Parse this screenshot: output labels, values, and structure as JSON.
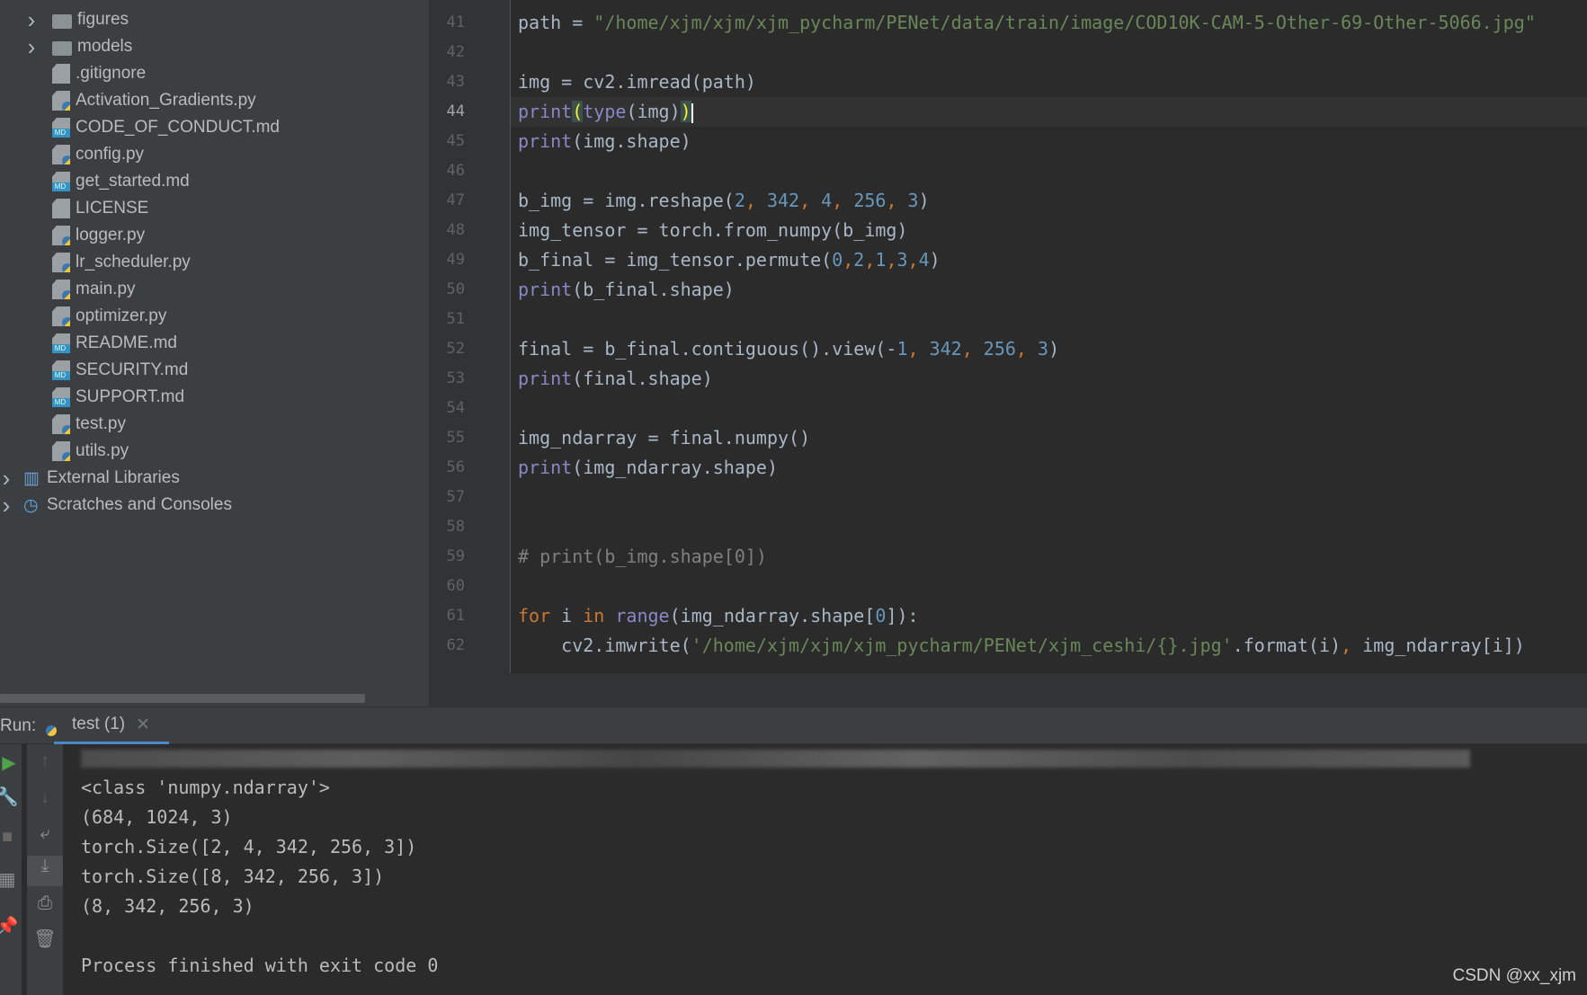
{
  "project_tree": [
    {
      "label": "figures",
      "type": "folder",
      "chevron": true,
      "level": 1
    },
    {
      "label": "models",
      "type": "folder",
      "chevron": true,
      "level": 1
    },
    {
      "label": ".gitignore",
      "type": "doc",
      "level": 1
    },
    {
      "label": "Activation_Gradients.py",
      "type": "py",
      "level": 1
    },
    {
      "label": "CODE_OF_CONDUCT.md",
      "type": "md",
      "level": 1
    },
    {
      "label": "config.py",
      "type": "py",
      "level": 1
    },
    {
      "label": "get_started.md",
      "type": "md",
      "level": 1
    },
    {
      "label": "LICENSE",
      "type": "doc",
      "level": 1
    },
    {
      "label": "logger.py",
      "type": "py",
      "level": 1
    },
    {
      "label": "lr_scheduler.py",
      "type": "py",
      "level": 1
    },
    {
      "label": "main.py",
      "type": "py",
      "level": 1
    },
    {
      "label": "optimizer.py",
      "type": "py",
      "level": 1
    },
    {
      "label": "README.md",
      "type": "md",
      "level": 1
    },
    {
      "label": "SECURITY.md",
      "type": "md",
      "level": 1
    },
    {
      "label": "SUPPORT.md",
      "type": "md",
      "level": 1
    },
    {
      "label": "test.py",
      "type": "py",
      "level": 1
    },
    {
      "label": "utils.py",
      "type": "py",
      "level": 1
    },
    {
      "label": "External Libraries",
      "type": "lib",
      "chevron": true,
      "level": 0
    },
    {
      "label": "Scratches and Consoles",
      "type": "scratch",
      "chevron": true,
      "level": 0
    }
  ],
  "editor": {
    "current_line": 44,
    "lines": [
      {
        "n": "41",
        "t": [
          [
            "path = ",
            ""
          ],
          [
            "\"/home/xjm/xjm/xjm_pycharm/PENet/data/train/image/COD10K-CAM-5-Other-69-Other-5066.jpg\"",
            "s"
          ]
        ]
      },
      {
        "n": "42",
        "t": []
      },
      {
        "n": "43",
        "t": [
          [
            "img = cv2.imread(path)",
            ""
          ]
        ]
      },
      {
        "n": "44",
        "t": [
          [
            "print",
            "b"
          ],
          [
            "(",
            "br"
          ],
          [
            "type",
            "b"
          ],
          [
            "(img)",
            ""
          ],
          [
            ")",
            "br"
          ]
        ]
      },
      {
        "n": "45",
        "t": [
          [
            "print",
            "b"
          ],
          [
            "(img.shape)",
            ""
          ]
        ]
      },
      {
        "n": "46",
        "t": []
      },
      {
        "n": "47",
        "t": [
          [
            "b_img = img.reshape(",
            ""
          ],
          [
            "2",
            "n"
          ],
          [
            ", ",
            "k"
          ],
          [
            "342",
            "n"
          ],
          [
            ", ",
            "k"
          ],
          [
            "4",
            "n"
          ],
          [
            ", ",
            "k"
          ],
          [
            "256",
            "n"
          ],
          [
            ", ",
            "k"
          ],
          [
            "3",
            "n"
          ],
          [
            ")",
            ""
          ]
        ]
      },
      {
        "n": "48",
        "t": [
          [
            "img_tensor = torch.from_numpy(b_img)",
            ""
          ]
        ]
      },
      {
        "n": "49",
        "t": [
          [
            "b_final = img_tensor.permute(",
            ""
          ],
          [
            "0",
            "n"
          ],
          [
            ",",
            "k"
          ],
          [
            "2",
            "n"
          ],
          [
            ",",
            "k"
          ],
          [
            "1",
            "n"
          ],
          [
            ",",
            "k"
          ],
          [
            "3",
            "n"
          ],
          [
            ",",
            "k"
          ],
          [
            "4",
            "n"
          ],
          [
            ")",
            ""
          ]
        ]
      },
      {
        "n": "50",
        "t": [
          [
            "print",
            "b"
          ],
          [
            "(b_final.shape)",
            ""
          ]
        ]
      },
      {
        "n": "51",
        "t": []
      },
      {
        "n": "52",
        "t": [
          [
            "final = b_final.contiguous().view(-",
            ""
          ],
          [
            "1",
            "n"
          ],
          [
            ", ",
            "k"
          ],
          [
            "342",
            "n"
          ],
          [
            ", ",
            "k"
          ],
          [
            "256",
            "n"
          ],
          [
            ", ",
            "k"
          ],
          [
            "3",
            "n"
          ],
          [
            ")",
            ""
          ]
        ]
      },
      {
        "n": "53",
        "t": [
          [
            "print",
            "b"
          ],
          [
            "(final.shape)",
            ""
          ]
        ]
      },
      {
        "n": "54",
        "t": []
      },
      {
        "n": "55",
        "t": [
          [
            "img_ndarray = final.numpy()",
            ""
          ]
        ]
      },
      {
        "n": "56",
        "t": [
          [
            "print",
            "b"
          ],
          [
            "(img_ndarray.shape)",
            ""
          ]
        ]
      },
      {
        "n": "57",
        "t": []
      },
      {
        "n": "58",
        "t": []
      },
      {
        "n": "59",
        "t": [
          [
            "# print(b_img.shape[0])",
            "c"
          ]
        ]
      },
      {
        "n": "60",
        "t": []
      },
      {
        "n": "61",
        "t": [
          [
            "for ",
            "k"
          ],
          [
            "i ",
            ""
          ],
          [
            "in ",
            "k"
          ],
          [
            "range",
            "b"
          ],
          [
            "(img_ndarray.shape[",
            ""
          ],
          [
            "0",
            "n"
          ],
          [
            "]):",
            ""
          ]
        ]
      },
      {
        "n": "62",
        "t": [
          [
            "    cv2.imwrite(",
            ""
          ],
          [
            "'/home/xjm/xjm/xjm_pycharm/PENet/xjm_ceshi/{}.jpg'",
            "s"
          ],
          [
            ".format(i)",
            ""
          ],
          [
            ", ",
            "k"
          ],
          [
            "img_ndarray[i])",
            ""
          ]
        ]
      }
    ]
  },
  "run_panel": {
    "label": "Run:",
    "tab_label": "test (1)",
    "output": [
      "<class 'numpy.ndarray'>",
      "(684, 1024, 3)",
      "torch.Size([2, 4, 342, 256, 3])",
      "torch.Size([8, 342, 256, 3])",
      "(8, 342, 256, 3)",
      "",
      "Process finished with exit code 0"
    ]
  },
  "watermark": "CSDN @xx_xjm"
}
